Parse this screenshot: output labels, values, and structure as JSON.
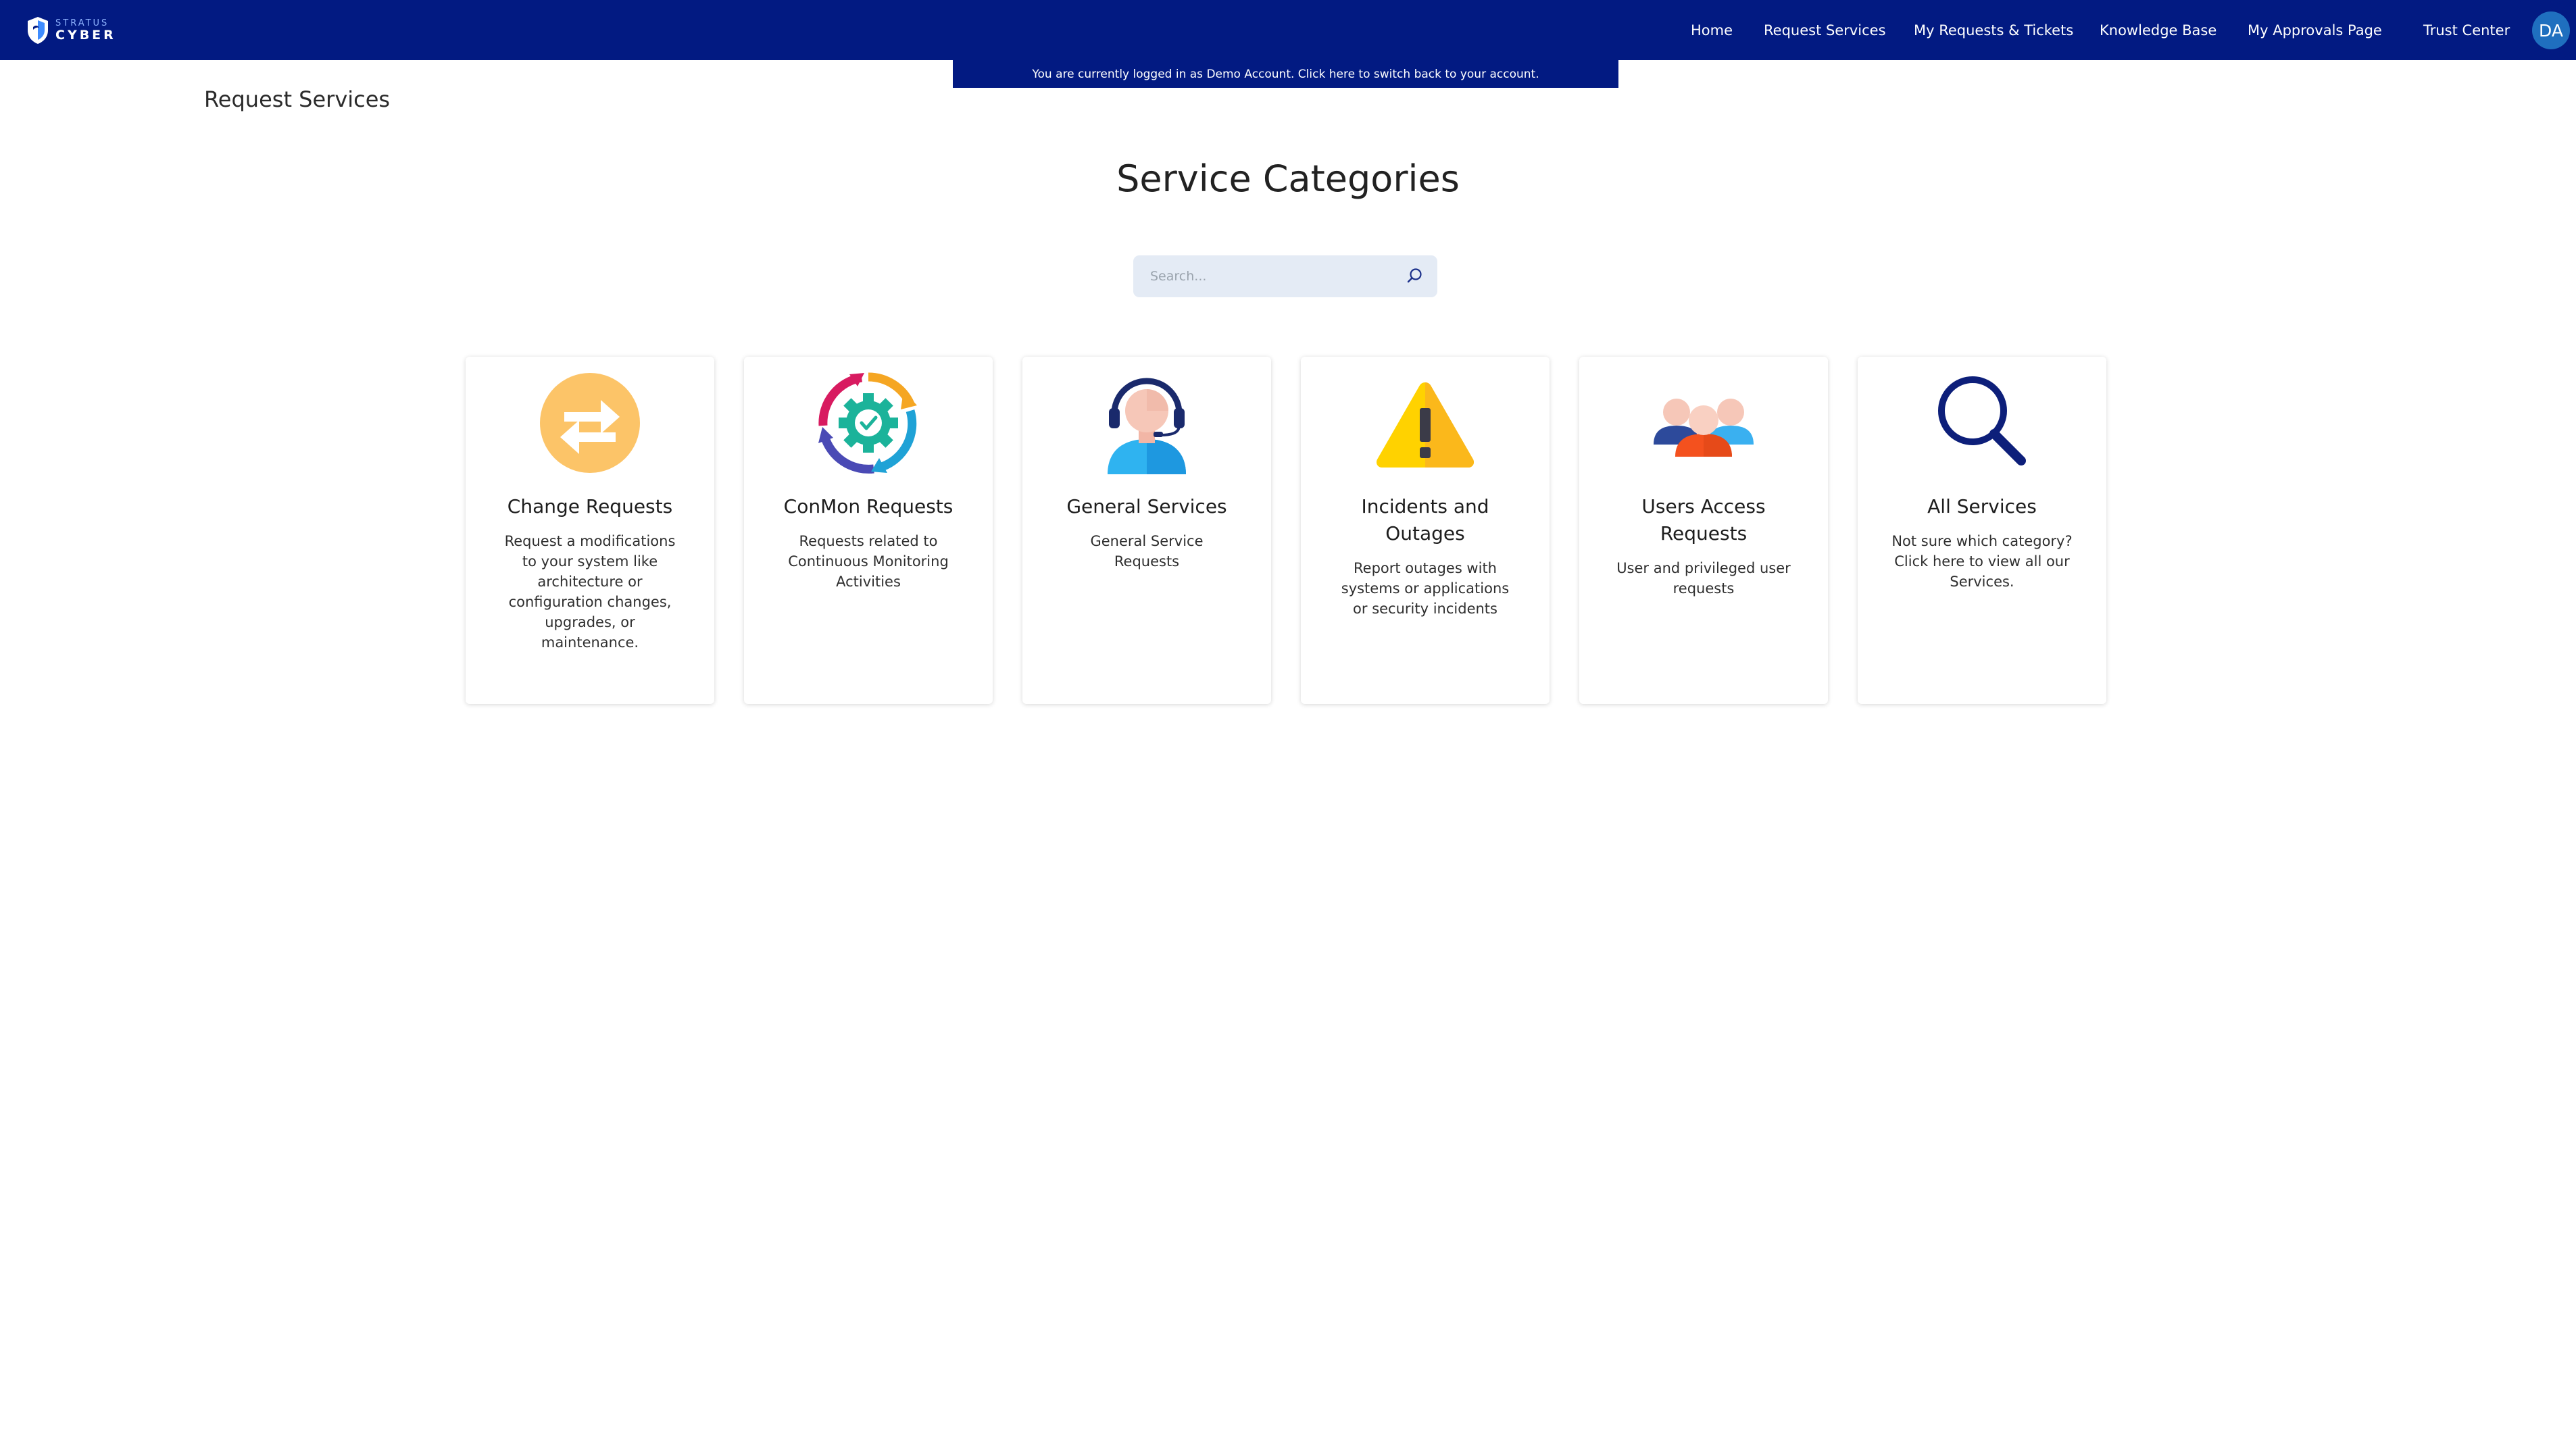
{
  "brand": {
    "top": "STRATUS",
    "bottom": "CYBER"
  },
  "nav": {
    "items": [
      {
        "label": "Home"
      },
      {
        "label": "Request Services"
      },
      {
        "label": "My Requests & Tickets"
      },
      {
        "label": "Knowledge Base"
      },
      {
        "label": "My Approvals Page"
      },
      {
        "label": "Trust Center"
      }
    ],
    "avatar": "DA"
  },
  "banner": {
    "text": "You are currently logged in as Demo Account. Click here to switch back to your account."
  },
  "breadcrumb": {
    "title": "Request Services"
  },
  "main": {
    "title": "Service Categories",
    "search": {
      "placeholder": "Search...",
      "value": ""
    },
    "cards": [
      {
        "title": "Change Requests",
        "description": "Request a modifications to your system like architecture or configuration changes, upgrades, or maintenance.",
        "icon": "swap-arrows-icon"
      },
      {
        "title": "ConMon Requests",
        "description": "Requests related to Continuous Monitoring Activities",
        "icon": "gear-cycle-icon"
      },
      {
        "title": "General Services",
        "description": "General Service Requests",
        "icon": "headset-agent-icon"
      },
      {
        "title": "Incidents and Outages",
        "description": "Report outages with systems or applications or security incidents",
        "icon": "warning-triangle-icon"
      },
      {
        "title": "Users Access Requests",
        "description": "User and privileged user requests",
        "icon": "users-group-icon"
      },
      {
        "title": "All Services",
        "description": "Not sure which category? Click here to view all our Services.",
        "icon": "magnifier-icon"
      }
    ]
  },
  "colors": {
    "navbar": "#021a82",
    "search_bg": "#e4ebf5",
    "avatar": "#1f6fbf"
  }
}
